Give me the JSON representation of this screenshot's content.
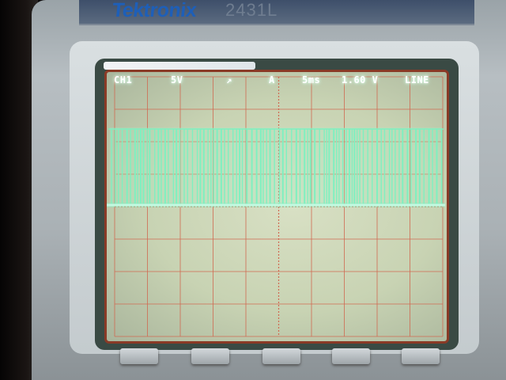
{
  "brand": {
    "name": "Tektronix",
    "model": "2431L"
  },
  "readout": {
    "channel": "CH1",
    "volts_per_div": "5V",
    "trigger_slope": "↗",
    "trigger_mode": "A",
    "time_per_div": "5ms",
    "trigger_level": "1.60 V",
    "trigger_source": "LINE"
  },
  "colors": {
    "trace": "#7ff0c0",
    "screen_bg": "#c8d3b3",
    "graticule": "#d06a52",
    "bezel": "#aab1b5"
  },
  "icons": {
    "trigger_slope": "rising-edge-icon"
  }
}
